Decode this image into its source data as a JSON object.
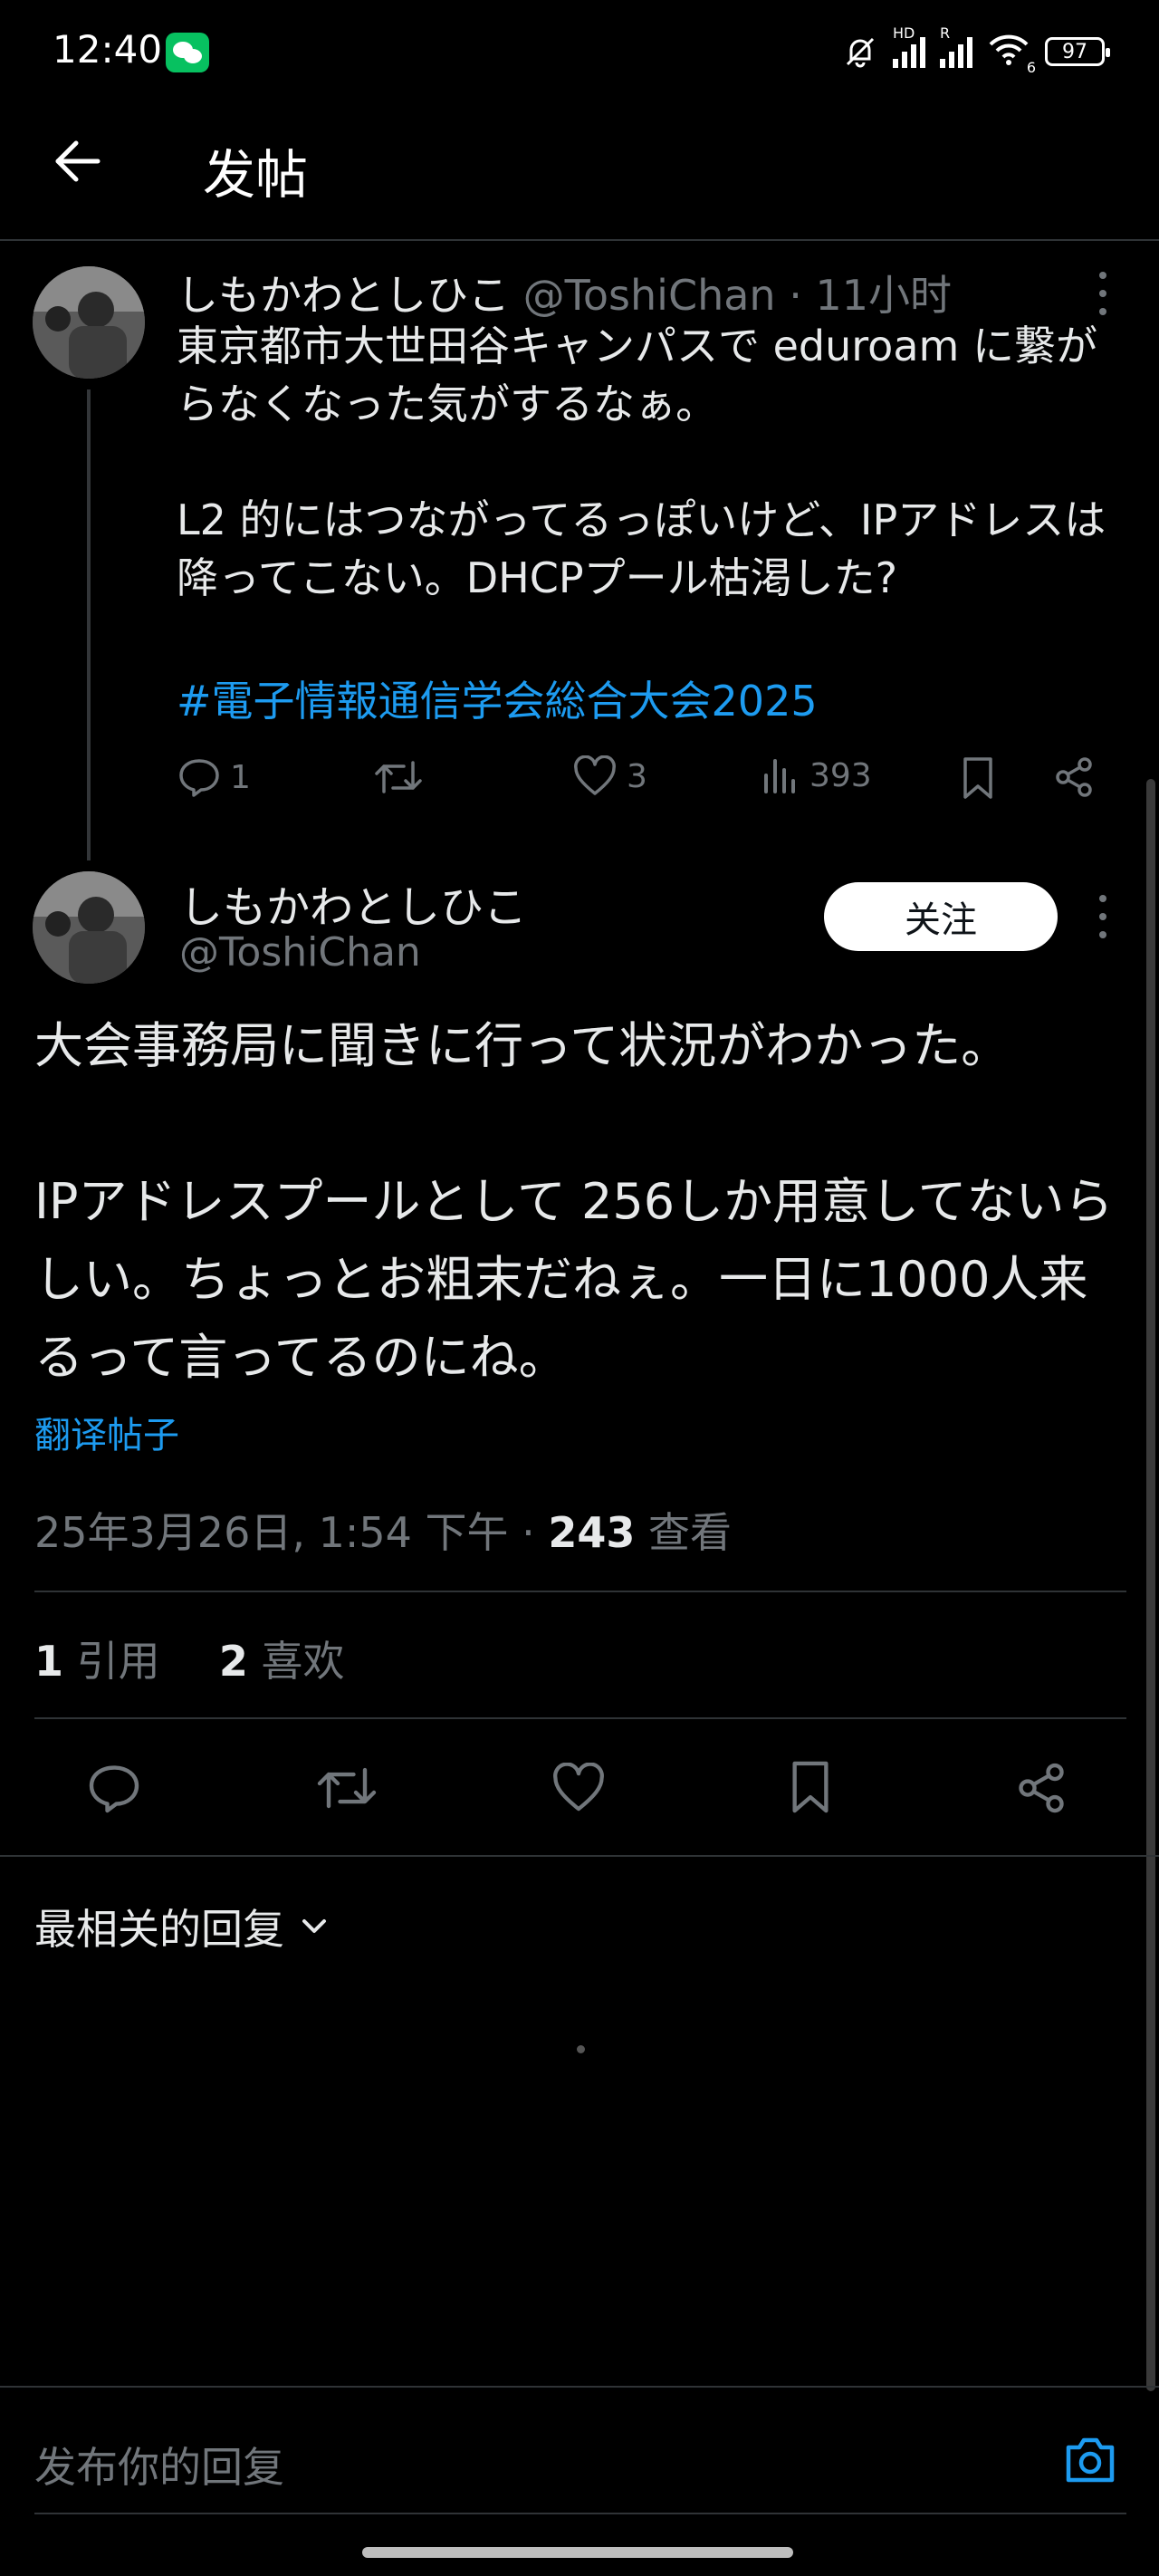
{
  "status_bar": {
    "time": "12:40",
    "signal1_label": "HD",
    "signal2_label": "R",
    "wifi_label": "6",
    "battery": "97"
  },
  "header": {
    "title": "发帖"
  },
  "parent_tweet": {
    "name": "しもかわとしひこ",
    "handle": "@ToshiChan",
    "time": "· 11小时",
    "text": "東京都市大世田谷キャンパスで eduroam に繋がらなくなった気がするなぁ。\n\nL2 的にはつながってるっぽいけど、IPアドレスは降ってこない。DHCPプール枯渇した?",
    "hashtag": "#電子情報通信学会総合大会2025",
    "replies": "1",
    "likes": "3",
    "views": "393"
  },
  "main_tweet": {
    "name": "しもかわとしひこ",
    "handle": "@ToshiChan",
    "follow_label": "关注",
    "text": "大会事務局に聞きに行って状況がわかった。\n\nIPアドレスプールとして 256しか用意してないらしい。ちょっとお粗末だねぇ。一日に1000人来るって言ってるのにね。",
    "translate_label": "翻译帖子",
    "date": "25年3月26日, 1:54 下午 · ",
    "views_count": "243",
    "views_label": " 查看",
    "quotes_count": "1",
    "quotes_label": " 引用",
    "likes_count": "2",
    "likes_label": " 喜欢"
  },
  "replies_section": {
    "sort_label": "最相关的回复"
  },
  "reply_bar": {
    "placeholder": "发布你的回复"
  },
  "colors": {
    "accent": "#1d9bf0",
    "muted": "#71767b",
    "background": "#000000"
  }
}
